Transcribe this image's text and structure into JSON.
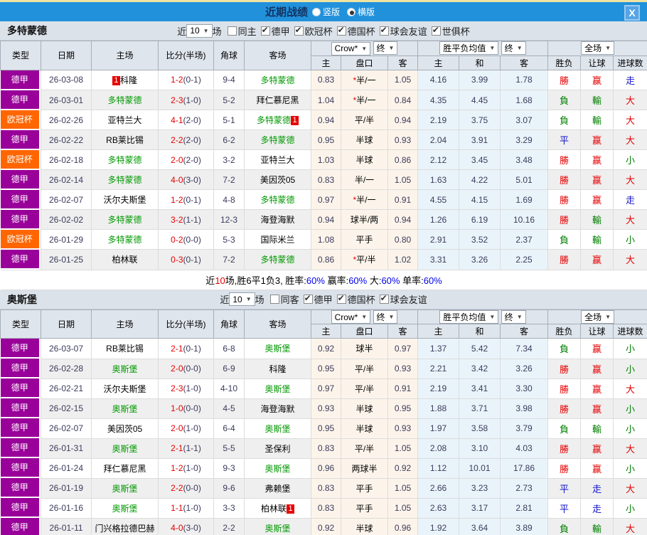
{
  "titlebar": {
    "title": "近期战绩",
    "radio_vertical": "竖版",
    "radio_horizontal": "横版",
    "close": "X"
  },
  "columns": {
    "type": "类型",
    "date": "日期",
    "home": "主场",
    "score": "比分(半场)",
    "corner": "角球",
    "away": "客场",
    "sub_home": "主",
    "handicap": "盘口",
    "sub_away": "客",
    "mean_home": "主",
    "mean_draw": "和",
    "mean_away": "客",
    "result": "胜负",
    "handicap_result": "让球",
    "goals": "进球数",
    "crow_select": "Crow*",
    "final_select": "终",
    "mean_select": "胜平负均值",
    "final2_select": "终",
    "full_select": "全场"
  },
  "result_colors": {
    "勝": "#e60000",
    "負": "#008000",
    "平": "#1414cc",
    "赢": "#e60000",
    "輸": "#008000",
    "走": "#1414cc",
    "大": "#e60000",
    "小": "#008000"
  },
  "league_colors": {
    "德甲": "#990099",
    "欧冠杯": "#ff6600"
  },
  "sections": [
    {
      "team": "多特蒙德",
      "filter": {
        "near": "近",
        "count": "10",
        "games": "场",
        "same": "同主",
        "same_checked": false,
        "leagues": [
          {
            "label": "德甲",
            "checked": true
          },
          {
            "label": "欧冠杯",
            "checked": true
          },
          {
            "label": "德国杯",
            "checked": true
          },
          {
            "label": "球会友谊",
            "checked": true
          },
          {
            "label": "世俱杯",
            "checked": true
          }
        ]
      },
      "rows": [
        {
          "league": "德甲",
          "date": "26-03-08",
          "home": {
            "name": "科隆",
            "green": false,
            "card": "1",
            "card_pos": "before"
          },
          "score": "1-2",
          "half": "0-1",
          "corner": "9-4",
          "away": {
            "name": "多特蒙德",
            "green": true
          },
          "o": [
            "0.83",
            "*半/一",
            "1.05"
          ],
          "m": [
            "4.16",
            "3.99",
            "1.78"
          ],
          "r": [
            "勝",
            "赢",
            "走"
          ]
        },
        {
          "league": "德甲",
          "date": "26-03-01",
          "home": {
            "name": "多特蒙德",
            "green": true
          },
          "score": "2-3",
          "half": "1-0",
          "corner": "5-2",
          "away": {
            "name": "拜仁慕尼黑",
            "green": false
          },
          "o": [
            "1.04",
            "*半/一",
            "0.84"
          ],
          "m": [
            "4.35",
            "4.45",
            "1.68"
          ],
          "r": [
            "負",
            "輸",
            "大"
          ]
        },
        {
          "league": "欧冠杯",
          "date": "26-02-26",
          "home": {
            "name": "亚特兰大",
            "green": false
          },
          "score": "4-1",
          "half": "2-0",
          "corner": "5-1",
          "away": {
            "name": "多特蒙德",
            "green": true,
            "card": "1",
            "card_pos": "after"
          },
          "o": [
            "0.94",
            "平/半",
            "0.94"
          ],
          "m": [
            "2.19",
            "3.75",
            "3.07"
          ],
          "r": [
            "負",
            "輸",
            "大"
          ]
        },
        {
          "league": "德甲",
          "date": "26-02-22",
          "home": {
            "name": "RB莱比锡",
            "green": false
          },
          "score": "2-2",
          "half": "2-0",
          "corner": "6-2",
          "away": {
            "name": "多特蒙德",
            "green": true
          },
          "o": [
            "0.95",
            "半球",
            "0.93"
          ],
          "m": [
            "2.04",
            "3.91",
            "3.29"
          ],
          "r": [
            "平",
            "赢",
            "大"
          ]
        },
        {
          "league": "欧冠杯",
          "date": "26-02-18",
          "home": {
            "name": "多特蒙德",
            "green": true
          },
          "score": "2-0",
          "half": "2-0",
          "corner": "3-2",
          "away": {
            "name": "亚特兰大",
            "green": false
          },
          "o": [
            "1.03",
            "半球",
            "0.86"
          ],
          "m": [
            "2.12",
            "3.45",
            "3.48"
          ],
          "r": [
            "勝",
            "赢",
            "小"
          ]
        },
        {
          "league": "德甲",
          "date": "26-02-14",
          "home": {
            "name": "多特蒙德",
            "green": true
          },
          "score": "4-0",
          "half": "3-0",
          "corner": "7-2",
          "away": {
            "name": "美因茨05",
            "green": false
          },
          "o": [
            "0.83",
            "半/一",
            "1.05"
          ],
          "m": [
            "1.63",
            "4.22",
            "5.01"
          ],
          "r": [
            "勝",
            "赢",
            "大"
          ]
        },
        {
          "league": "德甲",
          "date": "26-02-07",
          "home": {
            "name": "沃尔夫斯堡",
            "green": false
          },
          "score": "1-2",
          "half": "0-1",
          "corner": "4-8",
          "away": {
            "name": "多特蒙德",
            "green": true
          },
          "o": [
            "0.97",
            "*半/一",
            "0.91"
          ],
          "m": [
            "4.55",
            "4.15",
            "1.69"
          ],
          "r": [
            "勝",
            "赢",
            "走"
          ]
        },
        {
          "league": "德甲",
          "date": "26-02-02",
          "home": {
            "name": "多特蒙德",
            "green": true
          },
          "score": "3-2",
          "half": "1-1",
          "corner": "12-3",
          "away": {
            "name": "海登海默",
            "green": false
          },
          "o": [
            "0.94",
            "球半/两",
            "0.94"
          ],
          "m": [
            "1.26",
            "6.19",
            "10.16"
          ],
          "r": [
            "勝",
            "輸",
            "大"
          ]
        },
        {
          "league": "欧冠杯",
          "date": "26-01-29",
          "home": {
            "name": "多特蒙德",
            "green": true
          },
          "score": "0-2",
          "half": "0-0",
          "corner": "5-3",
          "away": {
            "name": "国际米兰",
            "green": false
          },
          "o": [
            "1.08",
            "平手",
            "0.80"
          ],
          "m": [
            "2.91",
            "3.52",
            "2.37"
          ],
          "r": [
            "負",
            "輸",
            "小"
          ]
        },
        {
          "league": "德甲",
          "date": "26-01-25",
          "home": {
            "name": "柏林联",
            "green": false
          },
          "score": "0-3",
          "half": "0-1",
          "corner": "7-2",
          "away": {
            "name": "多特蒙德",
            "green": true
          },
          "o": [
            "0.86",
            "*平/半",
            "1.02"
          ],
          "m": [
            "3.31",
            "3.26",
            "2.25"
          ],
          "r": [
            "勝",
            "赢",
            "大"
          ]
        }
      ],
      "summary": [
        {
          "t": "近",
          "c": ""
        },
        {
          "t": "10",
          "c": "#e60000"
        },
        {
          "t": "场,胜6平1负3, 胜率:",
          "c": ""
        },
        {
          "t": "60%",
          "c": "#0000ee"
        },
        {
          "t": " 赢率:",
          "c": ""
        },
        {
          "t": "60%",
          "c": "#0000ee"
        },
        {
          "t": " 大:",
          "c": ""
        },
        {
          "t": "60%",
          "c": "#0000ee"
        },
        {
          "t": " 单率:",
          "c": ""
        },
        {
          "t": "60%",
          "c": "#0000ee"
        }
      ]
    },
    {
      "team": "奥斯堡",
      "filter": {
        "near": "近",
        "count": "10",
        "games": "场",
        "same": "同客",
        "same_checked": false,
        "leagues": [
          {
            "label": "德甲",
            "checked": true
          },
          {
            "label": "德国杯",
            "checked": true
          },
          {
            "label": "球会友谊",
            "checked": true
          }
        ]
      },
      "rows": [
        {
          "league": "德甲",
          "date": "26-03-07",
          "home": {
            "name": "RB莱比锡",
            "green": false
          },
          "score": "2-1",
          "half": "0-1",
          "corner": "6-8",
          "away": {
            "name": "奥斯堡",
            "green": true
          },
          "o": [
            "0.92",
            "球半",
            "0.97"
          ],
          "m": [
            "1.37",
            "5.42",
            "7.34"
          ],
          "r": [
            "負",
            "赢",
            "小"
          ]
        },
        {
          "league": "德甲",
          "date": "26-02-28",
          "home": {
            "name": "奥斯堡",
            "green": true
          },
          "score": "2-0",
          "half": "0-0",
          "corner": "6-9",
          "away": {
            "name": "科隆",
            "green": false
          },
          "o": [
            "0.95",
            "平/半",
            "0.93"
          ],
          "m": [
            "2.21",
            "3.42",
            "3.26"
          ],
          "r": [
            "勝",
            "赢",
            "小"
          ]
        },
        {
          "league": "德甲",
          "date": "26-02-21",
          "home": {
            "name": "沃尔夫斯堡",
            "green": false
          },
          "score": "2-3",
          "half": "1-0",
          "corner": "4-10",
          "away": {
            "name": "奥斯堡",
            "green": true
          },
          "o": [
            "0.97",
            "平/半",
            "0.91"
          ],
          "m": [
            "2.19",
            "3.41",
            "3.30"
          ],
          "r": [
            "勝",
            "赢",
            "大"
          ]
        },
        {
          "league": "德甲",
          "date": "26-02-15",
          "home": {
            "name": "奥斯堡",
            "green": true
          },
          "score": "1-0",
          "half": "0-0",
          "corner": "4-5",
          "away": {
            "name": "海登海默",
            "green": false
          },
          "o": [
            "0.93",
            "半球",
            "0.95"
          ],
          "m": [
            "1.88",
            "3.71",
            "3.98"
          ],
          "r": [
            "勝",
            "赢",
            "小"
          ]
        },
        {
          "league": "德甲",
          "date": "26-02-07",
          "home": {
            "name": "美因茨05",
            "green": false
          },
          "score": "2-0",
          "half": "1-0",
          "corner": "6-4",
          "away": {
            "name": "奥斯堡",
            "green": true
          },
          "o": [
            "0.95",
            "半球",
            "0.93"
          ],
          "m": [
            "1.97",
            "3.58",
            "3.79"
          ],
          "r": [
            "負",
            "輸",
            "小"
          ]
        },
        {
          "league": "德甲",
          "date": "26-01-31",
          "home": {
            "name": "奥斯堡",
            "green": true
          },
          "score": "2-1",
          "half": "1-1",
          "corner": "5-5",
          "away": {
            "name": "圣保利",
            "green": false
          },
          "o": [
            "0.83",
            "平/半",
            "1.05"
          ],
          "m": [
            "2.08",
            "3.10",
            "4.03"
          ],
          "r": [
            "勝",
            "赢",
            "大"
          ]
        },
        {
          "league": "德甲",
          "date": "26-01-24",
          "home": {
            "name": "拜仁慕尼黑",
            "green": false
          },
          "score": "1-2",
          "half": "1-0",
          "corner": "9-3",
          "away": {
            "name": "奥斯堡",
            "green": true
          },
          "o": [
            "0.96",
            "两球半",
            "0.92"
          ],
          "m": [
            "1.12",
            "10.01",
            "17.86"
          ],
          "r": [
            "勝",
            "赢",
            "小"
          ]
        },
        {
          "league": "德甲",
          "date": "26-01-19",
          "home": {
            "name": "奥斯堡",
            "green": true
          },
          "score": "2-2",
          "half": "0-0",
          "corner": "9-6",
          "away": {
            "name": "弗赖堡",
            "green": false
          },
          "o": [
            "0.83",
            "平手",
            "1.05"
          ],
          "m": [
            "2.66",
            "3.23",
            "2.73"
          ],
          "r": [
            "平",
            "走",
            "大"
          ]
        },
        {
          "league": "德甲",
          "date": "26-01-16",
          "home": {
            "name": "奥斯堡",
            "green": true
          },
          "score": "1-1",
          "half": "1-0",
          "corner": "3-3",
          "away": {
            "name": "柏林联",
            "green": false,
            "card": "1",
            "card_pos": "after"
          },
          "o": [
            "0.83",
            "平手",
            "1.05"
          ],
          "m": [
            "2.63",
            "3.17",
            "2.81"
          ],
          "r": [
            "平",
            "走",
            "小"
          ]
        },
        {
          "league": "德甲",
          "date": "26-01-11",
          "home": {
            "name": "门兴格拉德巴赫",
            "green": false
          },
          "score": "4-0",
          "half": "3-0",
          "corner": "2-2",
          "away": {
            "name": "奥斯堡",
            "green": true
          },
          "o": [
            "0.92",
            "半球",
            "0.96"
          ],
          "m": [
            "1.92",
            "3.64",
            "3.89"
          ],
          "r": [
            "負",
            "輸",
            "大"
          ]
        }
      ],
      "summary": null
    }
  ]
}
